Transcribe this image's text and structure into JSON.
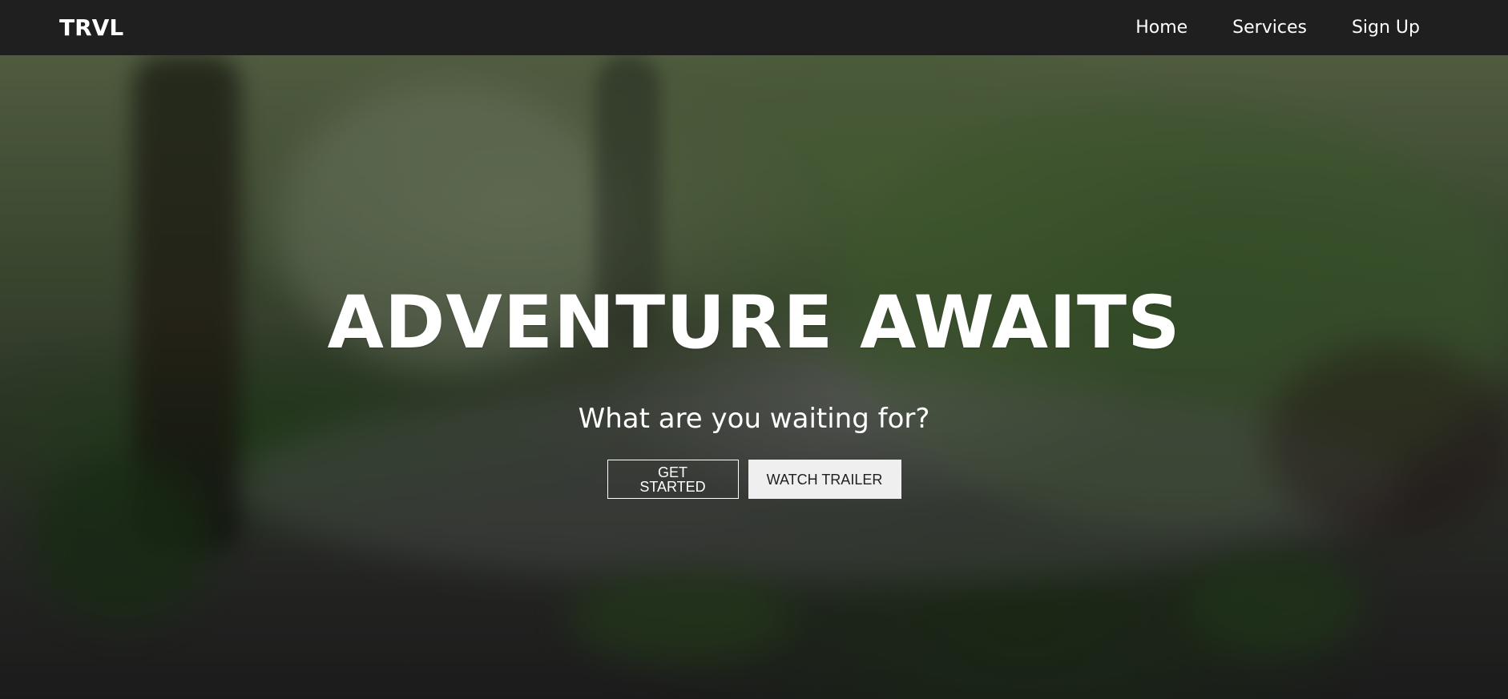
{
  "header": {
    "logo": "TRVL",
    "nav": [
      {
        "label": "Home"
      },
      {
        "label": "Services"
      },
      {
        "label": "Sign Up"
      }
    ]
  },
  "hero": {
    "title": "ADVENTURE AWAITS",
    "subtitle": "What are you waiting for?",
    "buttons": {
      "primary": "GET STARTED",
      "secondary": "WATCH TRAILER"
    }
  },
  "colors": {
    "navbar_background": "#1f1f1f",
    "text": "#ffffff",
    "secondary_button_background": "#efefef",
    "secondary_button_text": "#1f1f1f"
  }
}
